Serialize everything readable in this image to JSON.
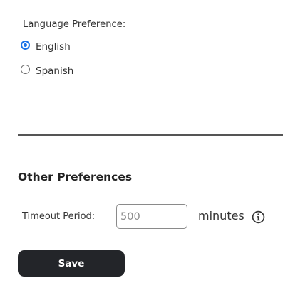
{
  "language": {
    "label": "Language Preference:",
    "options": [
      {
        "label": "English",
        "checked": true
      },
      {
        "label": "Spanish",
        "checked": false
      }
    ]
  },
  "other_preferences": {
    "title": "Other Preferences",
    "timeout": {
      "label": "Timeout Period:",
      "placeholder": "500",
      "value": "",
      "unit": "minutes",
      "info_icon": "info-circle-icon"
    }
  },
  "actions": {
    "save_label": "Save"
  },
  "colors": {
    "accent": "#1a73e8",
    "button_bg": "#232529"
  }
}
